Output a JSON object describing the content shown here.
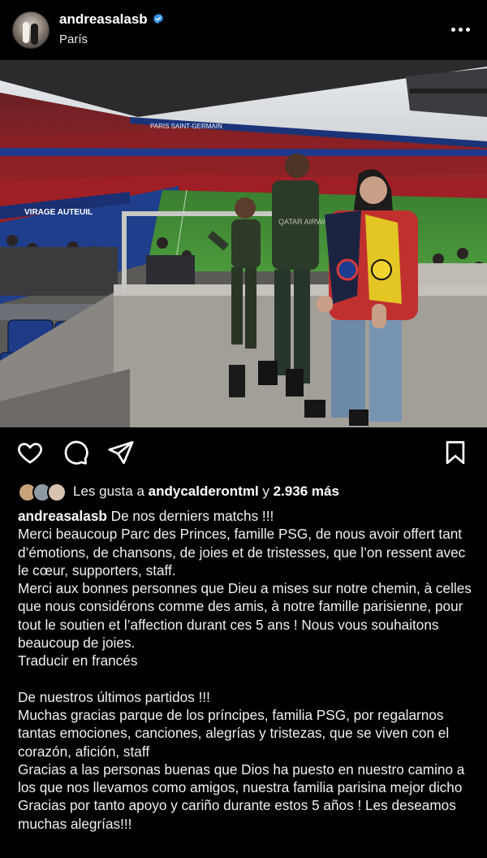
{
  "header": {
    "username": "andreasalasb",
    "location": "París",
    "more_icon": "more-horizontal-icon",
    "verified_icon": "verified-badge-icon"
  },
  "photo": {
    "banner_text": "PARIS SAINT-GERMAIN",
    "board_text": "VIRAGE AUTEUIL",
    "shirt_text": "QATAR AIRWAYS"
  },
  "actions": {
    "like_icon": "heart-icon",
    "comment_icon": "comment-icon",
    "share_icon": "send-icon",
    "save_icon": "bookmark-icon"
  },
  "likes": {
    "prefix": "Les gusta a",
    "user": "andycalderontml",
    "connector": "y",
    "count": "2.936 más"
  },
  "caption": {
    "username": "andreasalasb",
    "first_line": "De nos derniers matchs !!!",
    "fr_paragraph_1": "Merci beaucoup Parc des Princes, famille PSG, de nous avoir offert tant d’émotions, de chansons, de joies et de tristesses, que l’on ressent avec le cœur, supporters, staff.",
    "fr_paragraph_2": "Merci aux bonnes personnes que Dieu a mises sur notre chemin, à celles que nous considérons comme des amis, à notre famille parisienne, pour tout le soutien et l’affection durant ces 5 ans ! Nous vous souhaitons beaucoup de joies.",
    "translate_link": "Traducir en francés",
    "es_line_1": "De nuestros últimos partidos !!!",
    "es_paragraph_1": "Muchas gracias parque de los príncipes, familia PSG, por regalarnos tantas emociones, canciones, alegrías y tristezas, que se viven con el corazón, afición, staff",
    "es_paragraph_2": "Gracias a las personas buenas que Dios ha puesto en nuestro camino a los que nos llevamos como amigos, nuestra familia parisina mejor dicho Gracias por tanto apoyo y cariño durante estos 5 años ! Les deseamos muchas alegrías!!!"
  },
  "colors": {
    "background": "#000000",
    "text": "#f5f5f5",
    "verified": "#3897f0",
    "pitch": "#3f8a34",
    "stands_red": "#b0262a",
    "seats_blue": "#1f3f8c"
  }
}
